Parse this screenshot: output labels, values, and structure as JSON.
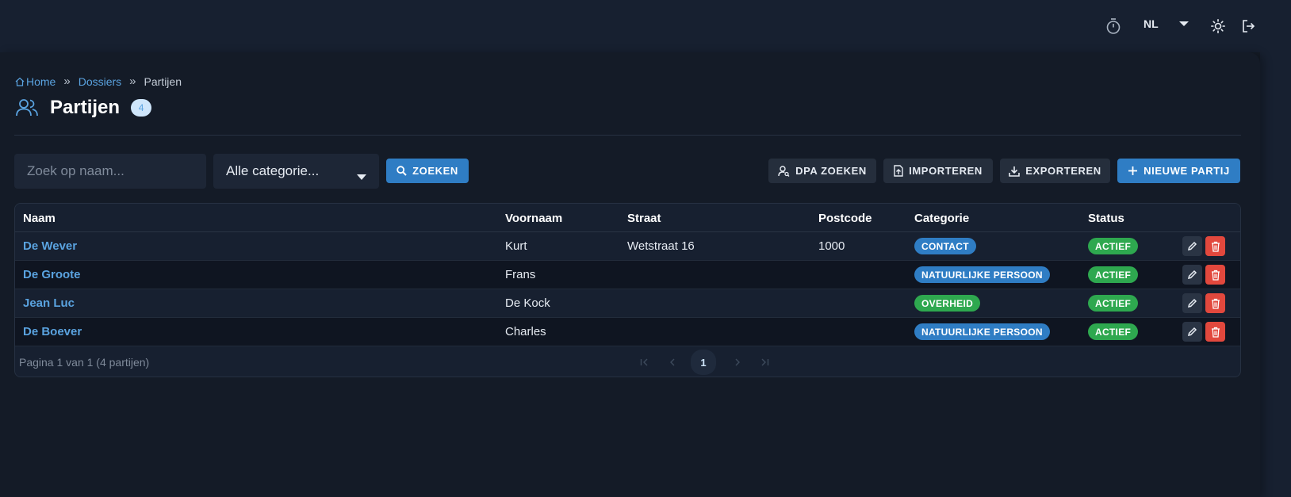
{
  "topbar": {
    "language": "NL",
    "icons": [
      "timer-icon",
      "chevron-down-icon",
      "sun-icon",
      "logout-icon"
    ]
  },
  "breadcrumb": {
    "home": "Home",
    "dossiers": "Dossiers",
    "current": "Partijen",
    "separator": "»"
  },
  "page": {
    "title": "Partijen",
    "count": "4"
  },
  "filters": {
    "search_placeholder": "Zoek op naam...",
    "category_selected": "Alle categorie...",
    "search_button": "ZOEKEN"
  },
  "actions": {
    "dpa_search": "DPA ZOEKEN",
    "import": "IMPORTEREN",
    "export": "EXPORTEREN",
    "new_party": "NIEUWE PARTIJ"
  },
  "table": {
    "columns": [
      "Naam",
      "Voornaam",
      "Straat",
      "Postcode",
      "Categorie",
      "Status"
    ],
    "rows": [
      {
        "naam": "De Wever",
        "voornaam": "Kurt",
        "straat": "Wetstraat 16",
        "postcode": "1000",
        "categorie": "CONTACT",
        "status": "ACTIEF"
      },
      {
        "naam": "De Groote",
        "voornaam": "Frans",
        "straat": "",
        "postcode": "",
        "categorie": "NATUURLIJKE PERSOON",
        "status": "ACTIEF"
      },
      {
        "naam": "Jean Luc",
        "voornaam": "De Kock",
        "straat": "",
        "postcode": "",
        "categorie": "OVERHEID",
        "status": "ACTIEF"
      },
      {
        "naam": "De Boever",
        "voornaam": "Charles",
        "straat": "",
        "postcode": "",
        "categorie": "NATUURLIJKE PERSOON",
        "status": "ACTIEF"
      }
    ]
  },
  "pagination": {
    "info": "Pagina 1 van 1 (4 partijen)",
    "current_page": "1"
  },
  "colors": {
    "accent": "#2f7dc4",
    "link": "#5aa3e0",
    "success": "#2ea84f",
    "danger": "#e2483d",
    "background": "#151c27"
  }
}
